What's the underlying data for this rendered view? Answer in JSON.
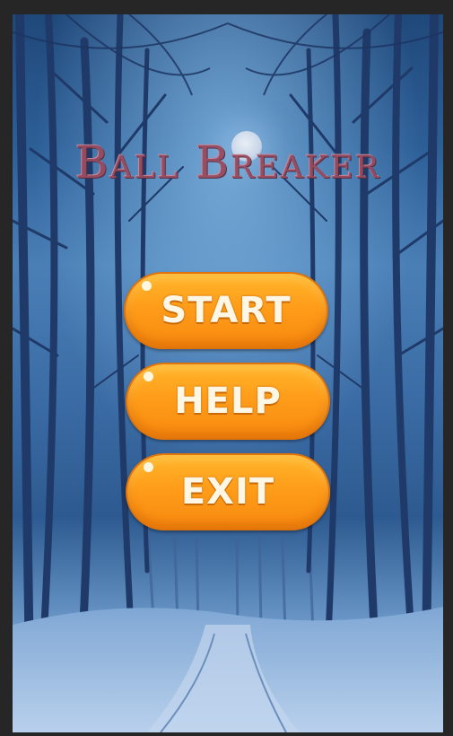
{
  "game": {
    "title": "Ball Breaker"
  },
  "menu": {
    "start_label": "START",
    "help_label": "HELP",
    "exit_label": "EXIT"
  },
  "colors": {
    "button_fill": "#ff9d1a",
    "button_border": "#e0740a",
    "title": "#9a4a5e",
    "sky": "#2c5e96",
    "snow": "#a9c6e6"
  },
  "icons": [
    "moon-icon"
  ]
}
